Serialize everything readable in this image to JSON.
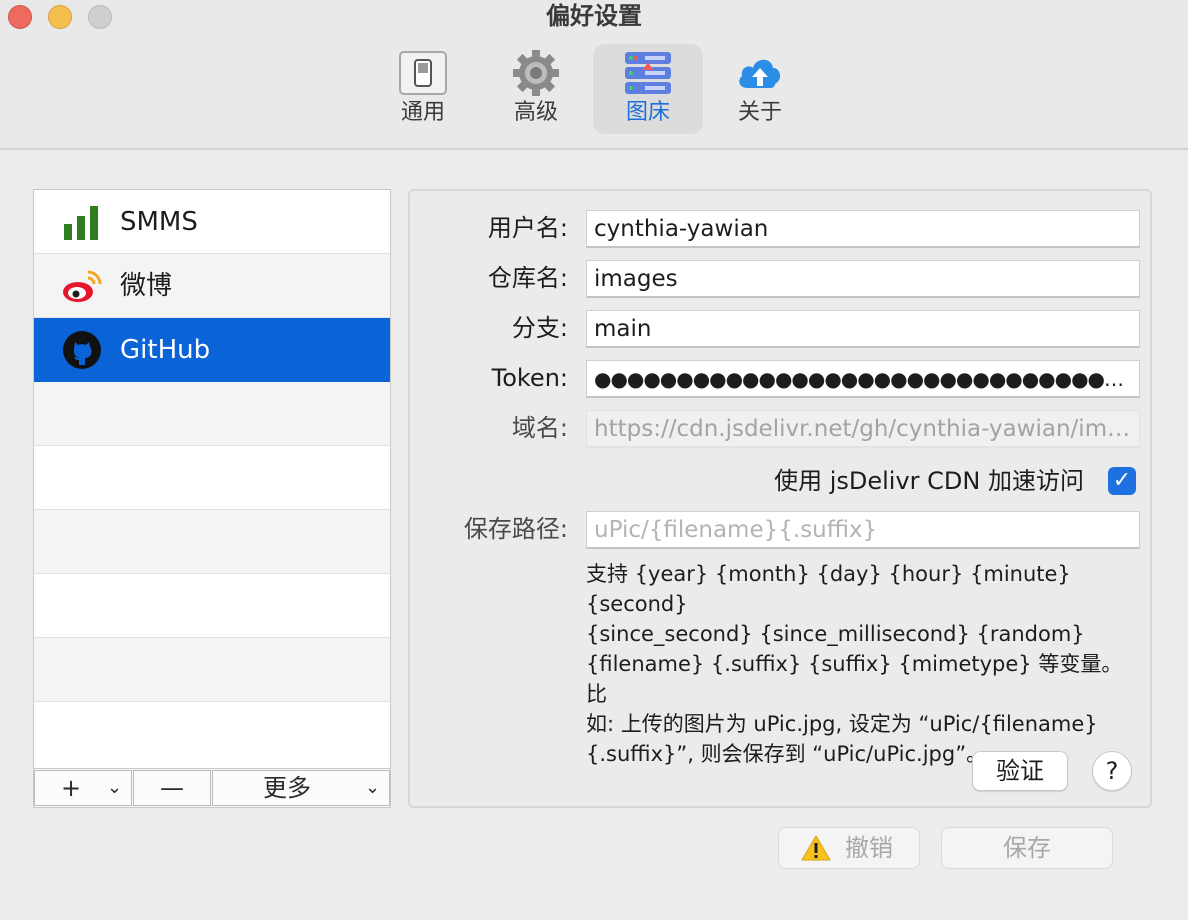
{
  "window": {
    "title": "偏好设置"
  },
  "tabs": [
    {
      "label": "通用",
      "icon": "switch-icon"
    },
    {
      "label": "高级",
      "icon": "gear-icon"
    },
    {
      "label": "图床",
      "icon": "server-icon",
      "active": true
    },
    {
      "label": "关于",
      "icon": "cloud-upload-icon"
    }
  ],
  "hosts": [
    {
      "label": "SMMS",
      "icon": "signal-bars-icon"
    },
    {
      "label": "微博",
      "icon": "weibo-icon"
    },
    {
      "label": "GitHub",
      "icon": "github-icon",
      "selected": true
    }
  ],
  "list_toolbar": {
    "add": "+",
    "add_menu": "⌄",
    "remove": "—",
    "more": "更多",
    "more_menu": "⌄"
  },
  "form": {
    "username_label": "用户名:",
    "username_value": "cynthia-yawian",
    "repo_label": "仓库名:",
    "repo_value": "images",
    "branch_label": "分支:",
    "branch_value": "main",
    "token_label": "Token:",
    "token_value": "●●●●●●●●●●●●●●●●●●●●●●●●●●●●●●●●●●●●●●●●…",
    "domain_label": "域名:",
    "domain_value": "https://cdn.jsdelivr.net/gh/cynthia-yawian/ima…",
    "cdn_label": "使用 jsDelivr CDN 加速访问",
    "cdn_checked": true,
    "path_label": "保存路径:",
    "path_placeholder": "uPic/{filename}{.suffix}",
    "help_lines": [
      "支持 {year} {month} {day} {hour} {minute} {second}",
      "{since_second} {since_millisecond} {random}",
      "{filename} {.suffix} {suffix} {mimetype} 等变量。比",
      "如: 上传的图片为 uPic.jpg, 设定为 “uPic/{filename}",
      "{.suffix}”, 则会保存到 “uPic/uPic.jpg”。"
    ],
    "verify_label": "验证",
    "help_label": "?"
  },
  "footer": {
    "cancel_label": "撤销",
    "cancel_icon": "warning-icon",
    "save_label": "保存"
  },
  "colors": {
    "accent": "#0b63d8",
    "checkbox": "#1f70e0",
    "close": "#ed6a5e",
    "minimize": "#f5bf4f"
  }
}
